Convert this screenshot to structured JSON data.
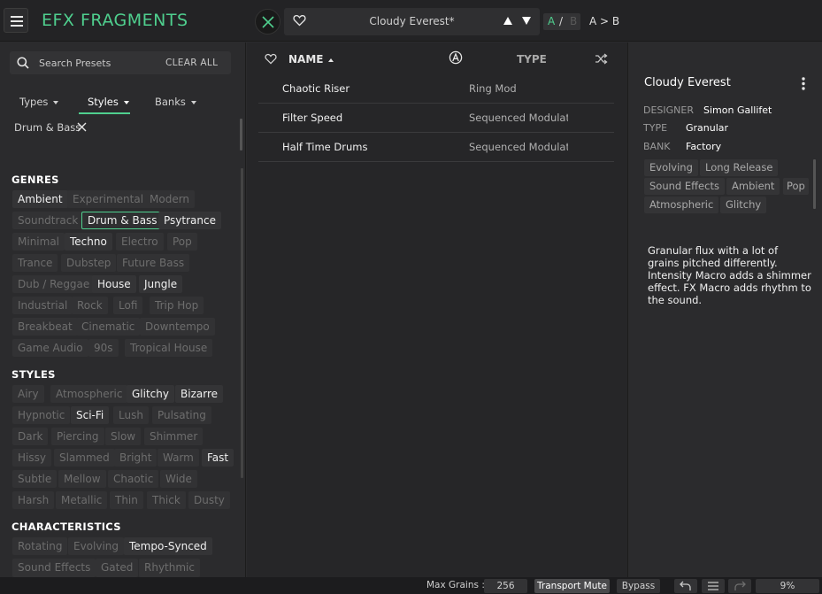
{
  "header": {
    "app_title": "EFX FRAGMENTS",
    "preset_name": "Cloudy Everest*",
    "ab_a": "A",
    "ab_slash": "/",
    "ab_b": "B",
    "ab_copy": "A > B"
  },
  "browser": {
    "search_placeholder": "Search Presets",
    "clear_all": "CLEAR ALL",
    "filter_tabs": [
      "Types",
      "Styles",
      "Banks"
    ],
    "active_tab": "Styles",
    "active_filter": "Drum & Bass",
    "sections": {
      "genres": "GENRES",
      "styles": "STYLES",
      "characteristics": "CHARACTERISTICS"
    },
    "genres": [
      "Ambient",
      "Experimental",
      "Modern",
      "Soundtrack",
      "Drum & Bass",
      "Psytrance",
      "Minimal",
      "Techno",
      "Electro",
      "Pop",
      "Trance",
      "Dubstep",
      "Future Bass",
      "Dub / Reggae",
      "House",
      "Jungle",
      "Industrial",
      "Rock",
      "Lofi",
      "Trip Hop",
      "Breakbeat",
      "Cinematic",
      "Downtempo",
      "Game Audio",
      "90s",
      "Tropical House"
    ],
    "styles": [
      "Airy",
      "Atmospheric",
      "Glitchy",
      "Bizarre",
      "Hypnotic",
      "Sci-Fi",
      "Lush",
      "Pulsating",
      "Dark",
      "Piercing",
      "Slow",
      "Shimmer",
      "Hissy",
      "Slammed",
      "Bright",
      "Warm",
      "Fast",
      "Subtle",
      "Mellow",
      "Chaotic",
      "Wide",
      "Harsh",
      "Metallic",
      "Thin",
      "Thick",
      "Dusty"
    ],
    "characteristics": [
      "Rotating",
      "Evolving",
      "Tempo-Synced",
      "Sound Effects",
      "Gated",
      "Rhythmic"
    ]
  },
  "results": {
    "col_name": "NAME",
    "col_type": "TYPE",
    "rows": [
      {
        "name": "Chaotic Riser",
        "type": "Ring Mod"
      },
      {
        "name": "Filter Speed",
        "type": "Sequenced Modulati"
      },
      {
        "name": "Half Time Drums",
        "type": "Sequenced Modulati"
      }
    ]
  },
  "info": {
    "name": "Cloudy Everest",
    "designer_label": "DESIGNER",
    "designer": "Simon Gallifet",
    "type_label": "TYPE",
    "type": "Granular",
    "bank_label": "BANK",
    "bank": "Factory",
    "tags": [
      "Evolving",
      "Long Release",
      "Sound Effects",
      "Ambient",
      "Pop",
      "Atmospheric",
      "Glitchy"
    ],
    "description": "Granular flux with a lot of grains pitched differently. Intensity Macro adds a shimmer effect. FX Macro adds rhythm to the sound."
  },
  "status": {
    "max_grains_label": "Max Grains :",
    "max_grains": "256",
    "transport_mute": "Transport Mute",
    "bypass": "Bypass",
    "cpu": "9%"
  },
  "colors": {
    "accent": "#4fcf8e",
    "background": "#2b2b2d",
    "panel_dark": "#262628"
  },
  "icons": [
    "hamburger-icon",
    "close-icon",
    "heart-icon",
    "arrow-up-icon",
    "arrow-down-icon",
    "search-icon",
    "creator-icon",
    "shuffle-icon",
    "kebab-icon",
    "undo-icon",
    "history-icon",
    "redo-icon"
  ]
}
